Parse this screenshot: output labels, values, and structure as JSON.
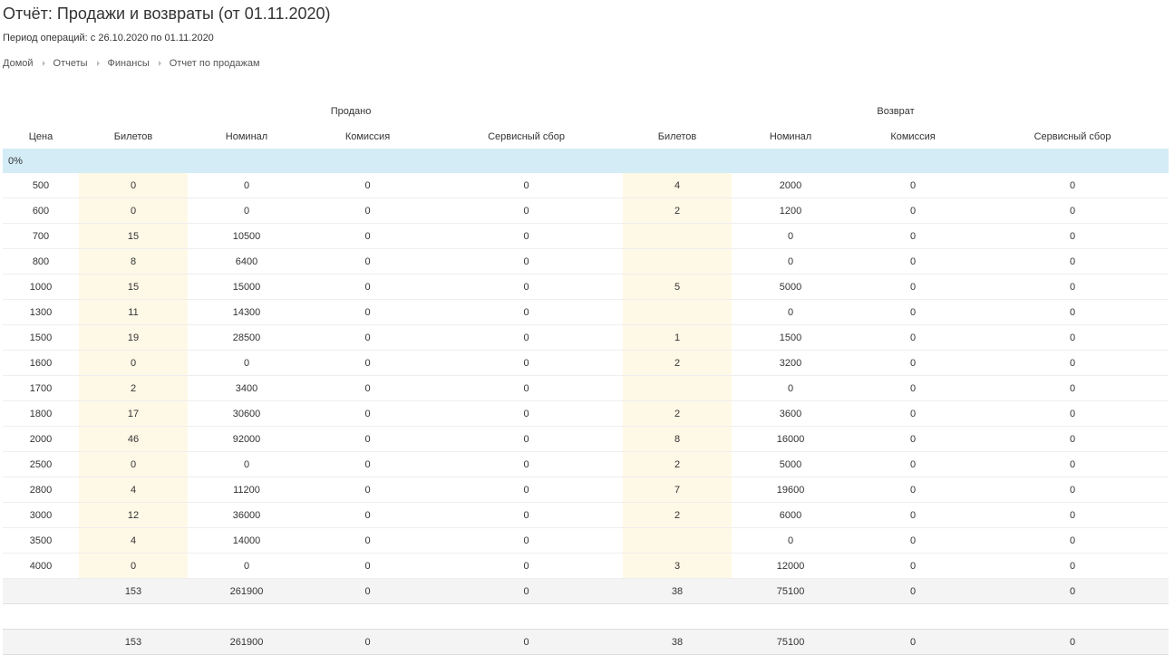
{
  "header": {
    "title": "Отчёт: Продажи и возвраты (от 01.11.2020)",
    "period": "Период операций: с 26.10.2020 по 01.11.2020"
  },
  "breadcrumbs": [
    {
      "label": "Домой"
    },
    {
      "label": "Отчеты"
    },
    {
      "label": "Финансы"
    },
    {
      "label": "Отчет по продажам"
    }
  ],
  "table": {
    "groups": {
      "sold": "Продано",
      "returned": "Возврат"
    },
    "columns": {
      "price": "Цена",
      "sold_tickets": "Билетов",
      "sold_nominal": "Номинал",
      "sold_commission": "Комиссия",
      "sold_service_fee": "Сервисный сбор",
      "ret_tickets": "Билетов",
      "ret_nominal": "Номинал",
      "ret_commission": "Комиссия",
      "ret_service_fee": "Сервисный сбор"
    },
    "section": "0%",
    "rows": [
      [
        "500",
        "0",
        "0",
        "0",
        "0",
        "4",
        "2000",
        "0",
        "0"
      ],
      [
        "600",
        "0",
        "0",
        "0",
        "0",
        "2",
        "1200",
        "0",
        "0"
      ],
      [
        "700",
        "15",
        "10500",
        "0",
        "0",
        "",
        "0",
        "0",
        "0"
      ],
      [
        "800",
        "8",
        "6400",
        "0",
        "0",
        "",
        "0",
        "0",
        "0"
      ],
      [
        "1000",
        "15",
        "15000",
        "0",
        "0",
        "5",
        "5000",
        "0",
        "0"
      ],
      [
        "1300",
        "11",
        "14300",
        "0",
        "0",
        "",
        "0",
        "0",
        "0"
      ],
      [
        "1500",
        "19",
        "28500",
        "0",
        "0",
        "1",
        "1500",
        "0",
        "0"
      ],
      [
        "1600",
        "0",
        "0",
        "0",
        "0",
        "2",
        "3200",
        "0",
        "0"
      ],
      [
        "1700",
        "2",
        "3400",
        "0",
        "0",
        "",
        "0",
        "0",
        "0"
      ],
      [
        "1800",
        "17",
        "30600",
        "0",
        "0",
        "2",
        "3600",
        "0",
        "0"
      ],
      [
        "2000",
        "46",
        "92000",
        "0",
        "0",
        "8",
        "16000",
        "0",
        "0"
      ],
      [
        "2500",
        "0",
        "0",
        "0",
        "0",
        "2",
        "5000",
        "0",
        "0"
      ],
      [
        "2800",
        "4",
        "11200",
        "0",
        "0",
        "7",
        "19600",
        "0",
        "0"
      ],
      [
        "3000",
        "12",
        "36000",
        "0",
        "0",
        "2",
        "6000",
        "0",
        "0"
      ],
      [
        "3500",
        "4",
        "14000",
        "0",
        "0",
        "",
        "0",
        "0",
        "0"
      ],
      [
        "4000",
        "0",
        "0",
        "0",
        "0",
        "3",
        "12000",
        "0",
        "0"
      ]
    ],
    "subtotal": [
      "",
      "153",
      "261900",
      "0",
      "0",
      "38",
      "75100",
      "0",
      "0"
    ],
    "grand_total": [
      "",
      "153",
      "261900",
      "0",
      "0",
      "38",
      "75100",
      "0",
      "0"
    ]
  }
}
